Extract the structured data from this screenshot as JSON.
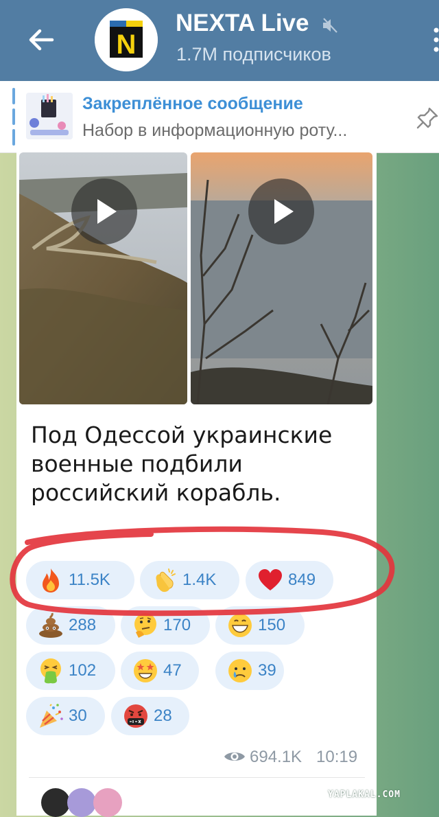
{
  "header": {
    "back_icon": "arrow-left-icon",
    "channel_name": "NEXTA Live",
    "subscribers": "1.7M подписчиков",
    "muted_icon": "speaker-muted-icon",
    "menu_icon": "more-vertical-icon",
    "avatar_letter": "N",
    "colors": {
      "header_bg": "#527da3",
      "avatar_blue": "#2b6cb0",
      "avatar_yellow": "#f5d10d"
    }
  },
  "pinned": {
    "title": "Закреплённое сообщение",
    "text": "Набор в информационную роту...",
    "pin_icon": "pin-icon"
  },
  "message": {
    "media": [
      {
        "type": "video",
        "icon": "play-icon"
      },
      {
        "type": "video",
        "icon": "play-icon"
      }
    ],
    "text": "Под Одессой украинские военные подбили российский корабль.",
    "reactions": [
      {
        "emoji": "fire",
        "count": "11.5K"
      },
      {
        "emoji": "clapping-hands",
        "count": "1.4K"
      },
      {
        "emoji": "red-heart",
        "count": "849"
      },
      {
        "emoji": "pile-of-poo",
        "count": "288"
      },
      {
        "emoji": "thinking-face",
        "count": "170"
      },
      {
        "emoji": "grinning-face",
        "count": "150"
      },
      {
        "emoji": "vomiting-face",
        "count": "102"
      },
      {
        "emoji": "star-struck",
        "count": "47"
      },
      {
        "emoji": "crying-face",
        "count": "39"
      },
      {
        "emoji": "party-popper",
        "count": "30"
      },
      {
        "emoji": "face-with-symbols-on-mouth",
        "count": "28"
      }
    ],
    "views_icon": "eye-icon",
    "views": "694.1K",
    "time": "10:19"
  },
  "watermark": "YAPLAKAL.COM",
  "colors": {
    "reaction_bg": "#e6f0fb",
    "reaction_text": "#3b83c6",
    "annotation": "#e3353d"
  }
}
